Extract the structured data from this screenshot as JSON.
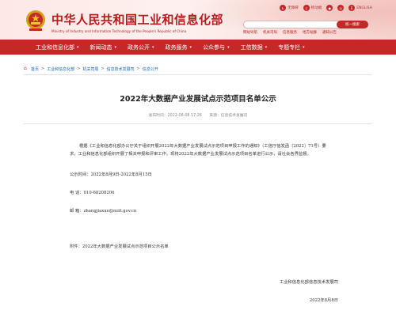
{
  "header": {
    "title": "中华人民共和国工业和信息化部",
    "subtitle": "Ministry of Industry and Information Technology of the People's Republic of China",
    "top_links": [
      {
        "icon": "accessibility-icon",
        "label": "无障碍"
      },
      {
        "icon": "mobile-icon",
        "label": "移动端"
      },
      {
        "icon": "weibo-icon",
        "label": ""
      },
      {
        "icon": "wechat-icon",
        "label": ""
      },
      {
        "icon": "language-icon",
        "label": "ENGLISH"
      }
    ],
    "search": {
      "placeholder": "",
      "button_label": "统一搜索"
    },
    "quick_links": [
      "网站导航",
      "机关司局",
      "信息服务",
      "地方站群",
      "通知公告"
    ]
  },
  "nav": {
    "items": [
      "工业和信息化部",
      "新闻动态",
      "政务公开",
      "政务服务",
      "公众参与",
      "工信数据",
      "专题专栏"
    ]
  },
  "breadcrumb": {
    "items": [
      "首页",
      "工业和信息化部",
      "机关司局",
      "信息技术发展司",
      "信息公开"
    ]
  },
  "article": {
    "title": "2022年大数据产业发展试点示范项目名单公示",
    "date_label": "发布时间：2022-08-08 17:26",
    "source_label": "来源：信息技术发展司",
    "paragraph": "根据《工业和信息化部办公厅关于组织开展2022年大数据产业发展试点示范项目申报工作的通知》（工信厅信发函〔2022〕71号）要求，工业和信息化部组织开展了相关申报和评审工作。现将2022年大数据产业发展试点示范项目名单进行公示，请社会各界监督。",
    "period": "公示时间：2022年8月9日-2022年8月15日",
    "phone_label": "电      话：010-68208206",
    "email_label": "邮      箱：zhangjiaxue@miit.gov.cn",
    "attachment": "附件：2022年大数据产业发展试点示范项目公示名单",
    "signature": "工业和信息化部信息技术发展司",
    "sign_date": "2022年8月8日"
  },
  "colors": {
    "brand_red": "#c62828",
    "link_blue": "#1565c0"
  }
}
